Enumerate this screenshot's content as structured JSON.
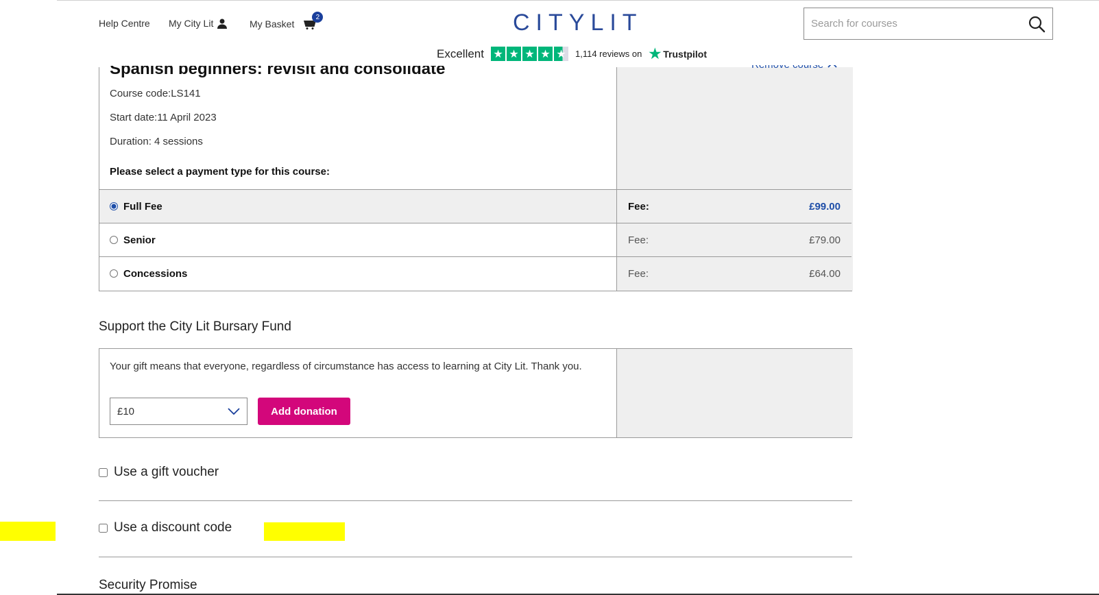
{
  "header": {
    "help_centre": "Help Centre",
    "my_city_lit": "My City Lit",
    "my_basket": "My Basket",
    "basket_count": "2",
    "logo": "CITYLIT",
    "search_placeholder": "Search for courses"
  },
  "trustpilot": {
    "rating_word": "Excellent",
    "reviews": "1,114 reviews on",
    "brand": "Trustpilot"
  },
  "course": {
    "title": "Spanish beginners: revisit and consolidate",
    "remove_label": "Remove course",
    "course_code": "Course code:LS141",
    "start_date": "Start date:11 April 2023",
    "duration": "Duration: 4 sessions",
    "payment_prompt": "Please select a payment type for this course:",
    "options": [
      {
        "label": "Full Fee",
        "fee_label": "Fee:",
        "amount": "£99.00",
        "selected": true
      },
      {
        "label": "Senior",
        "fee_label": "Fee:",
        "amount": "£79.00",
        "selected": false
      },
      {
        "label": "Concessions",
        "fee_label": "Fee:",
        "amount": "£64.00",
        "selected": false
      }
    ]
  },
  "bursary": {
    "heading": "Support the City Lit Bursary Fund",
    "text": "Your gift means that everyone, regardless of circumstance has access to learning at City Lit. Thank you.",
    "selected_amount": "£10",
    "button": "Add donation"
  },
  "options": {
    "gift_voucher": "Use a gift voucher",
    "discount_code": "Use a discount code"
  },
  "footer": {
    "security": "Security Promise"
  },
  "colors": {
    "accent_blue": "#1e4ea8",
    "donate_pink": "#d3077b",
    "trustpilot_green": "#00b67a",
    "highlight": "#ffff00"
  }
}
